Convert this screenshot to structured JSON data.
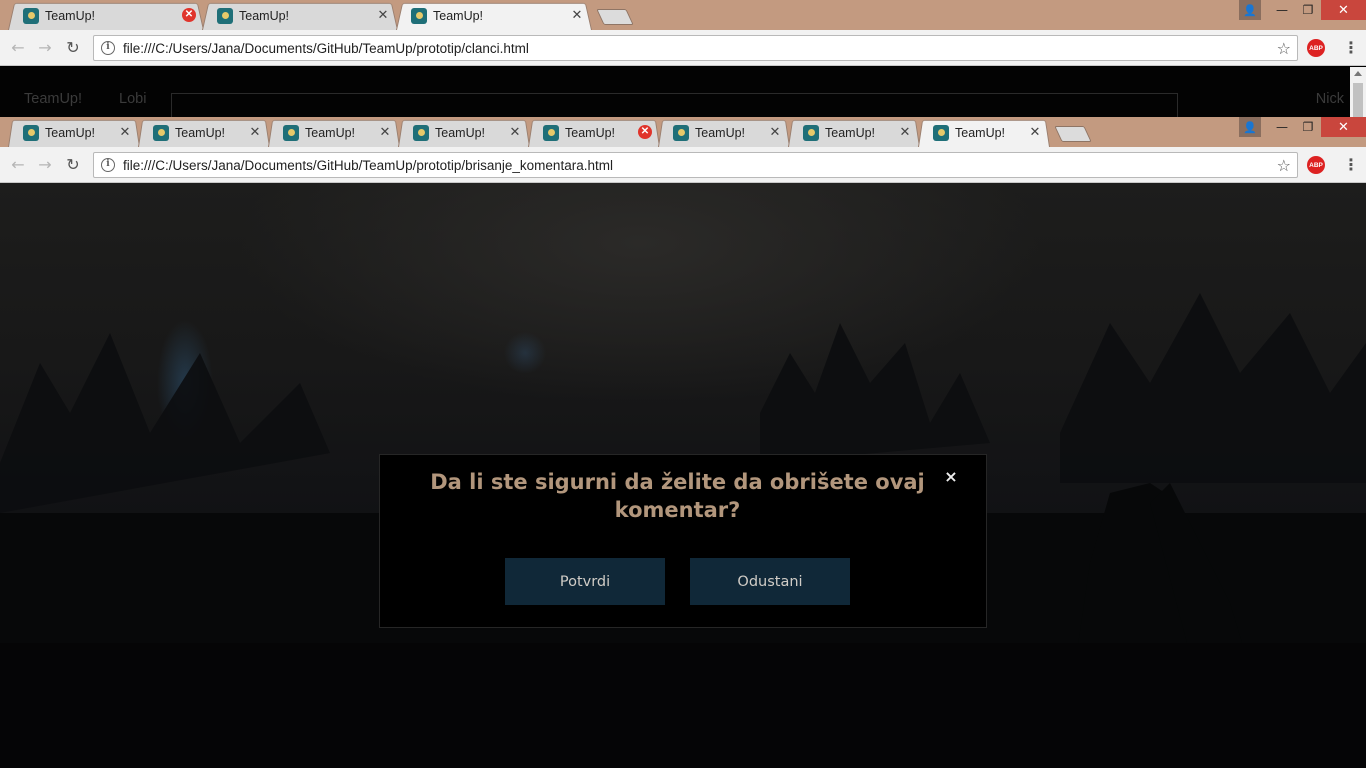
{
  "window1": {
    "tabs": [
      {
        "title": "TeamUp!",
        "close": "✕",
        "close_style": "red"
      },
      {
        "title": "TeamUp!",
        "close": "✕",
        "close_style": "normal"
      },
      {
        "title": "TeamUp!",
        "close": "✕",
        "close_style": "normal",
        "active": true
      }
    ],
    "url": "file:///C:/Users/Jana/Documents/GitHub/TeamUp/prototip/clanci.html",
    "page": {
      "brand": "TeamUp!",
      "nav_lobi": "Lobi",
      "user": "Nick"
    }
  },
  "window2": {
    "tabs": [
      {
        "title": "TeamUp!"
      },
      {
        "title": "TeamUp!"
      },
      {
        "title": "TeamUp!"
      },
      {
        "title": "TeamUp!"
      },
      {
        "title": "TeamUp!",
        "close_style": "red"
      },
      {
        "title": "TeamUp!"
      },
      {
        "title": "TeamUp!"
      },
      {
        "title": "TeamUp!",
        "active": true
      }
    ],
    "url": "file:///C:/Users/Jana/Documents/GitHub/TeamUp/prototip/brisanje_komentara.html"
  },
  "toolbar": {
    "back": "←",
    "forward": "→",
    "reload": "↻",
    "info": "i",
    "star": "☆",
    "abp": "ABP",
    "menu": "⋮"
  },
  "window_controls": {
    "user": "👤",
    "minimize": "—",
    "maximize": "❐",
    "close": "✕"
  },
  "dialog": {
    "title": "Da li ste sigurni da želite da obrišete ovaj komentar?",
    "close": "×",
    "confirm_label": "Potvrdi",
    "cancel_label": "Odustani"
  },
  "colors": {
    "titlebar": "#c39a80",
    "dialog_title": "#b2967c",
    "dialog_button_bg": "#102838"
  }
}
